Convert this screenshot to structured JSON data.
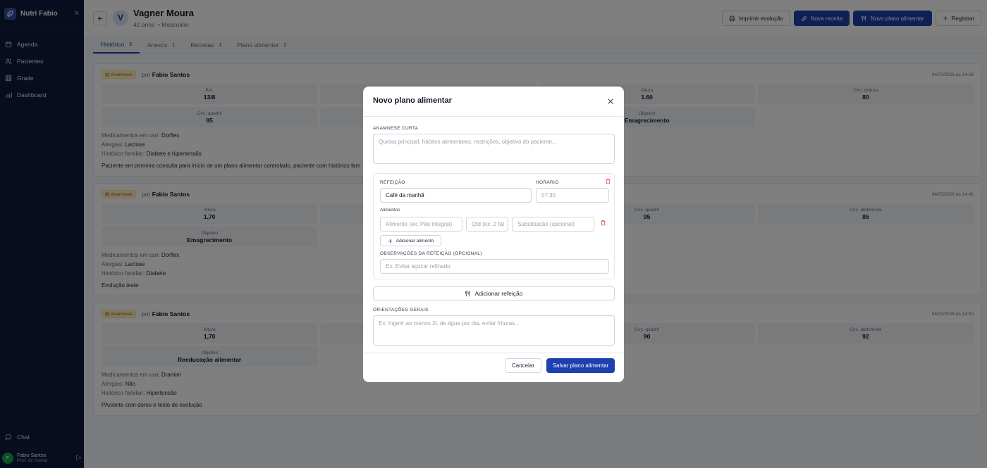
{
  "app": {
    "brand": "Nutri Fabio"
  },
  "sidebar": {
    "items": [
      {
        "label": "Agenda",
        "icon": "calendar-icon"
      },
      {
        "label": "Pacientes",
        "icon": "users-icon"
      },
      {
        "label": "Grade",
        "icon": "grid-icon"
      },
      {
        "label": "Dashboard",
        "icon": "chart-icon"
      }
    ],
    "chat": "Chat",
    "user": {
      "initial": "F",
      "name": "Fabio Santos",
      "role": "Prof. de Saúde"
    }
  },
  "patient": {
    "initial": "V",
    "name": "Vagner Moura",
    "age": "42 anos",
    "sex": "• Masculino"
  },
  "actions": {
    "print": "Imprimir evolução",
    "new_recipe": "Nova receita",
    "new_plan": "Novo plano alimentar",
    "register": "Registrar"
  },
  "tabs": [
    {
      "label": "Histórico",
      "count": "3"
    },
    {
      "label": "Anexos",
      "count": "1"
    },
    {
      "label": "Receitas",
      "count": "1"
    },
    {
      "label": "Plano alimentar",
      "count": "2"
    }
  ],
  "cards": [
    {
      "badge": "Anamnese",
      "by_prefix": "por",
      "author": "Fabio Santos",
      "date": "04/07/2026 às 14:28",
      "metrics": [
        {
          "label": "P.A.",
          "value": "13/8"
        },
        {
          "label": "",
          "value": ""
        },
        {
          "label": "Altura",
          "value": "1.60"
        },
        {
          "label": "Circ. cintura",
          "value": "80"
        },
        {
          "label": "Circ. quadril",
          "value": "95"
        },
        {
          "label": "",
          "value": ""
        },
        {
          "label": "Objetivo",
          "value": "Emagrecimento"
        }
      ],
      "meds_label": "Medicamentos em uso:",
      "meds": "Dorflex",
      "allergy_label": "Alergias:",
      "allergy": "Lactose",
      "family_label": "Histórico familiar:",
      "family": "Diabete e hipertensão",
      "note": "Paciente em primeira consulta para início de um plano alimentar controlado, paciente com histórico fam"
    },
    {
      "badge": "Anamnese",
      "by_prefix": "por",
      "author": "Fabio Santos",
      "date": "04/07/2026 às 14:42",
      "metrics": [
        {
          "label": "Altura",
          "value": "1,70"
        },
        {
          "label": "",
          "value": ""
        },
        {
          "label": "Circ. quadril",
          "value": "95"
        },
        {
          "label": "Circ. abdominal",
          "value": "85"
        },
        {
          "label": "Objetivo",
          "value": "Emagrecimento"
        }
      ],
      "meds_label": "Medicamentos em uso:",
      "meds": "Dorflex",
      "allergy_label": "Alergias:",
      "allergy": "Lactose",
      "family_label": "Histórico familiar:",
      "family": "Diabete",
      "note": "Evolução teste"
    },
    {
      "badge": "Anamnese",
      "by_prefix": "por",
      "author": "Fabio Santos",
      "date": "04/07/2026 às 14:50",
      "metrics": [
        {
          "label": "Altura",
          "value": "1,70"
        },
        {
          "label": "",
          "value": ""
        },
        {
          "label": "Circ. quadril",
          "value": "90"
        },
        {
          "label": "Circ. abdominal",
          "value": "92"
        },
        {
          "label": "Objetivo",
          "value": "Reeducação alimentar"
        }
      ],
      "meds_label": "Medicamentos em uso:",
      "meds": "Dramim",
      "allergy_label": "Alergias:",
      "allergy": "Não",
      "family_label": "Histórico familiar:",
      "family": "Hipertensão",
      "note": "PAciente com dores e teste de evolução"
    }
  ],
  "modal": {
    "title": "Novo plano alimentar",
    "anamnese_label": "ANAMNESE CURTA",
    "anamnese_placeholder": "Queixa principal, hábitos alimentares, restrições, objetivo do paciente...",
    "meal_label": "REFEIÇÃO",
    "meal_value": "Café da manhã",
    "time_label": "HORÁRIO",
    "time_placeholder": "07:30",
    "foods_label": "Alimentos",
    "food_placeholder": "Alimento (ex: Pão integral)",
    "qty_placeholder": "Qtd (ex: 2 fat",
    "sub_placeholder": "Substituição (opcional)",
    "add_food": "Adicionar alimento",
    "meal_obs_label": "OBSERVAÇÕES DA REFEIÇÃO (OPCIONAL)",
    "meal_obs_placeholder": "Ex: Evitar açúcar refinado",
    "add_meal": "Adicionar refeição",
    "general_label": "ORIENTAÇÕES GERAIS",
    "general_placeholder": "Ex: Ingerir ao menos 2L de água por dia, evitar frituras...",
    "cancel": "Cancelar",
    "save": "Salvar plano alimentar"
  }
}
